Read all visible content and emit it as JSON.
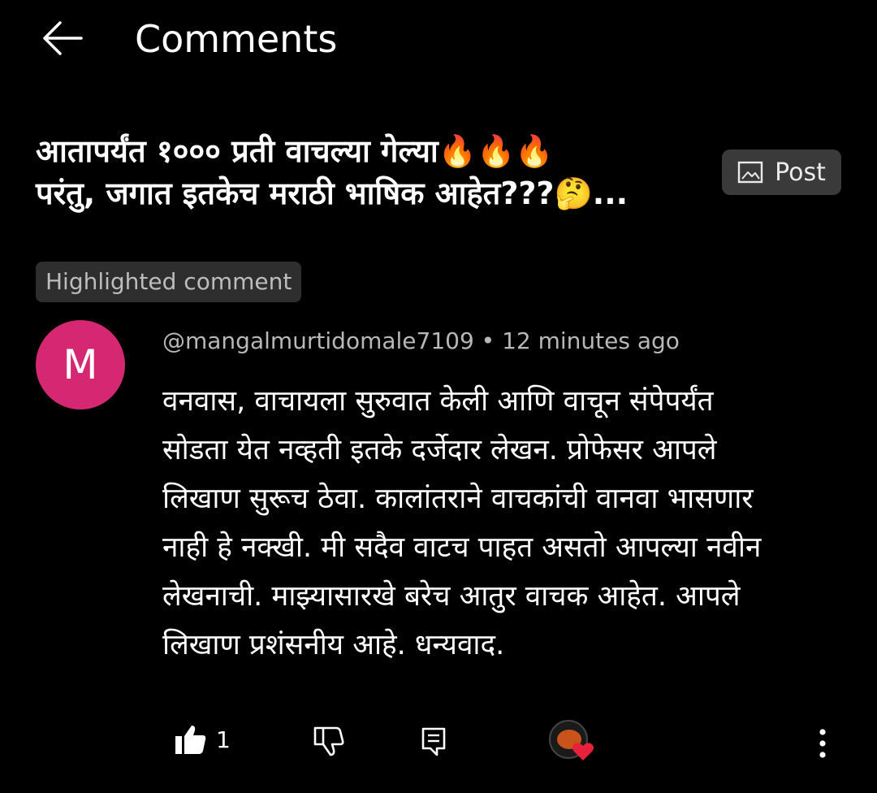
{
  "header": {
    "title": "Comments",
    "back_icon": "arrow-left-icon"
  },
  "post": {
    "title_line1": "आतापर्यंत १००० प्रती वाचल्या गेल्या🔥🔥🔥",
    "title_line2": "परंतु, जगात इतकेच मराठी भाषिक आहेत???🤔...",
    "post_button_label": "Post",
    "post_button_icon": "image-icon"
  },
  "highlighted_label": "Highlighted comment",
  "comment": {
    "avatar_letter": "M",
    "avatar_color": "#d62872",
    "meta": "@mangalmurtidomale7109 • 12 minutes ago",
    "lines": [
      "वनवास, वाचायला सुरुवात केली आणि वाचून संपेपर्यंत",
      "सोडता येत नव्हती  इतके दर्जेदार लेखन. प्रोफेसर आपले",
      "लिखाण सुरूच ठेवा. कालांतराने वाचकांची वानवा भासणार",
      "नाही हे नक्खी. मी सदैव वाटच पाहत असतो आपल्या नवीन",
      "लेखनाची. माझ्यासारखे बरेच आतुर वाचक आहेत. आपले",
      "लिखाण प्रशंसनीय आहे. धन्यवाद."
    ],
    "like_count": "1",
    "icons": {
      "like": "thumbs-up-icon",
      "dislike": "thumbs-down-icon",
      "reply": "reply-icon",
      "heart": "creator-heart-icon",
      "more": "more-vertical-icon"
    },
    "heart_color": "#e8213a"
  }
}
